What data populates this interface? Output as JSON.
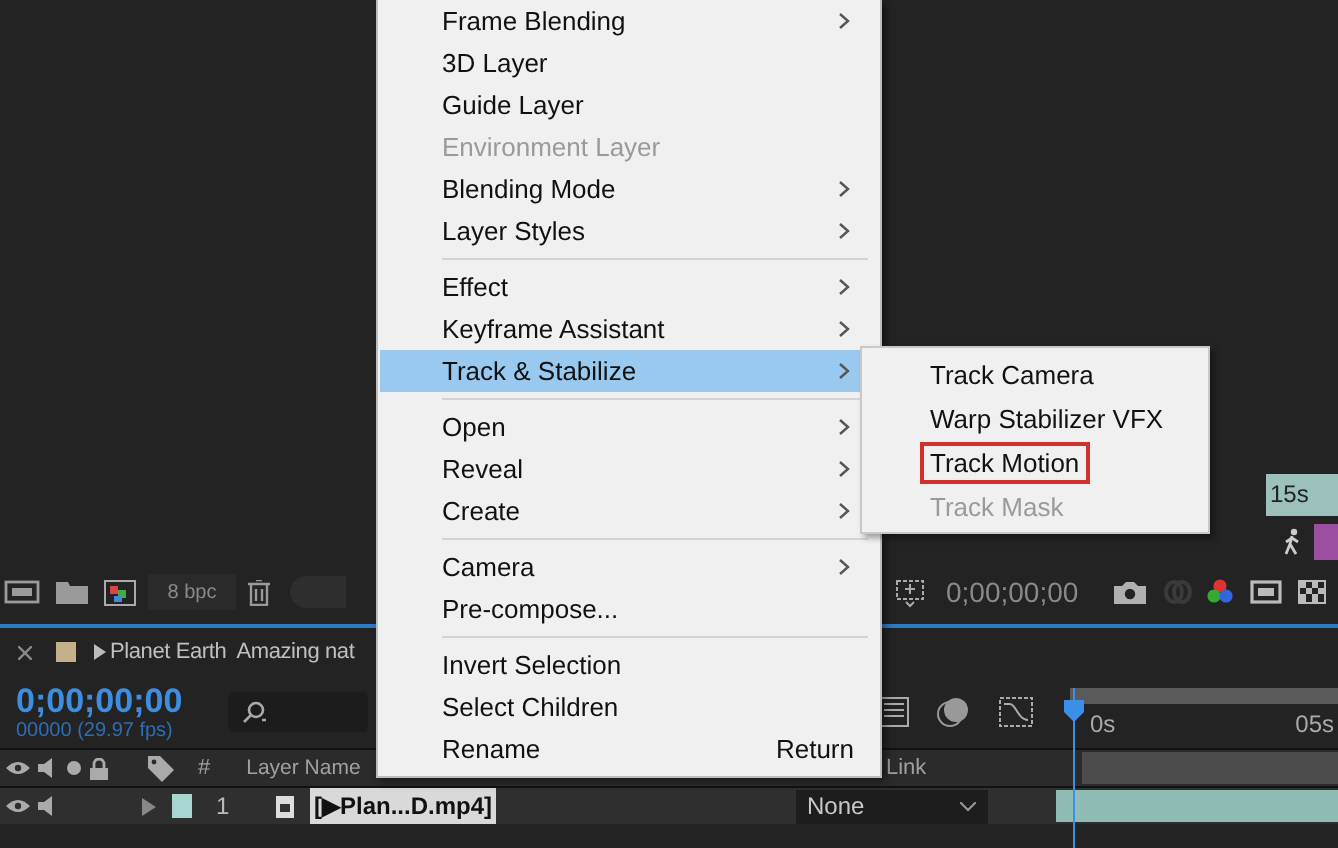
{
  "context_menu": {
    "items": [
      {
        "kind": "item",
        "label": "Frame Blending",
        "submenu": true,
        "disabled": false,
        "selected": false
      },
      {
        "kind": "item",
        "label": "3D Layer",
        "submenu": false,
        "disabled": false,
        "selected": false
      },
      {
        "kind": "item",
        "label": "Guide Layer",
        "submenu": false,
        "disabled": false,
        "selected": false
      },
      {
        "kind": "item",
        "label": "Environment Layer",
        "submenu": false,
        "disabled": true,
        "selected": false
      },
      {
        "kind": "item",
        "label": "Blending Mode",
        "submenu": true,
        "disabled": false,
        "selected": false
      },
      {
        "kind": "item",
        "label": "Layer Styles",
        "submenu": true,
        "disabled": false,
        "selected": false
      },
      {
        "kind": "separator"
      },
      {
        "kind": "item",
        "label": "Effect",
        "submenu": true,
        "disabled": false,
        "selected": false
      },
      {
        "kind": "item",
        "label": "Keyframe Assistant",
        "submenu": true,
        "disabled": false,
        "selected": false
      },
      {
        "kind": "item",
        "label": "Track & Stabilize",
        "submenu": true,
        "disabled": false,
        "selected": true
      },
      {
        "kind": "separator"
      },
      {
        "kind": "item",
        "label": "Open",
        "submenu": true,
        "disabled": false,
        "selected": false
      },
      {
        "kind": "item",
        "label": "Reveal",
        "submenu": true,
        "disabled": false,
        "selected": false
      },
      {
        "kind": "item",
        "label": "Create",
        "submenu": true,
        "disabled": false,
        "selected": false
      },
      {
        "kind": "separator"
      },
      {
        "kind": "item",
        "label": "Camera",
        "submenu": true,
        "disabled": false,
        "selected": false
      },
      {
        "kind": "item",
        "label": "Pre-compose...",
        "submenu": false,
        "disabled": false,
        "selected": false
      },
      {
        "kind": "separator"
      },
      {
        "kind": "item",
        "label": "Invert Selection",
        "submenu": false,
        "disabled": false,
        "selected": false
      },
      {
        "kind": "item",
        "label": "Select Children",
        "submenu": false,
        "disabled": false,
        "selected": false
      },
      {
        "kind": "item",
        "label": "Rename",
        "shortcut": "Return",
        "submenu": false,
        "disabled": false,
        "selected": false
      }
    ]
  },
  "submenu": {
    "items": [
      {
        "label": "Track Camera",
        "disabled": false,
        "outlined": false
      },
      {
        "label": "Warp Stabilizer VFX",
        "disabled": false,
        "outlined": false
      },
      {
        "label": "Track Motion",
        "disabled": false,
        "outlined": true
      },
      {
        "label": "Track Mask",
        "disabled": true,
        "outlined": false
      }
    ]
  },
  "top_ruler": {
    "label": "15s"
  },
  "viewer_toolbar": {
    "bit_depth": "8 bpc",
    "timecode": "0;00;00;00"
  },
  "timeline": {
    "tab_title": "Planet Earth  Amazing nat",
    "timecode": "0;00;00;00",
    "frame_info": "00000 (29.97 fps)",
    "ruler_labels": [
      "0s",
      "05s"
    ],
    "columns": {
      "number": "#",
      "layer_name": "Layer Name",
      "link": "Link"
    },
    "layers": [
      {
        "number": "1",
        "name": "[▶Plan...D.mp4]",
        "parent": "None"
      }
    ]
  }
}
